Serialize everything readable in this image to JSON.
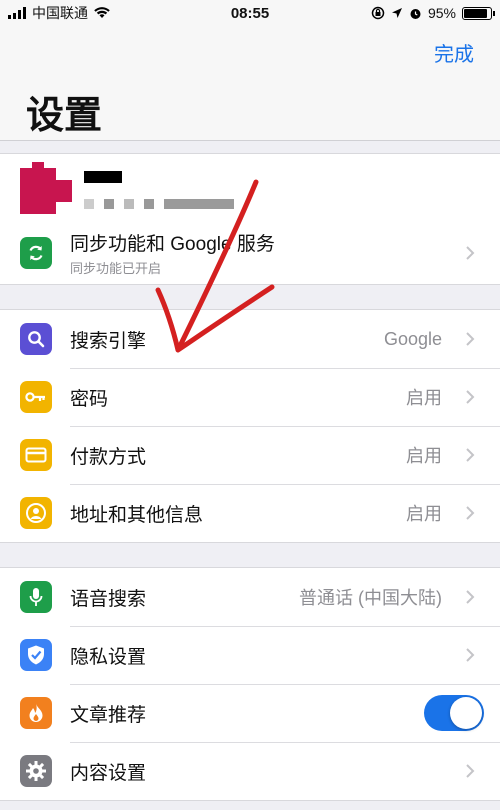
{
  "status": {
    "carrier": "中国联通",
    "time": "08:55",
    "battery": "95%",
    "battery_level": 0.95
  },
  "header": {
    "done_label": "完成",
    "title": "设置"
  },
  "sync": {
    "title": "同步功能和 Google 服务",
    "subtitle": "同步功能已开启"
  },
  "group2": [
    {
      "label": "搜索引擎",
      "value": "Google"
    },
    {
      "label": "密码",
      "value": "启用"
    },
    {
      "label": "付款方式",
      "value": "启用"
    },
    {
      "label": "地址和其他信息",
      "value": "启用"
    }
  ],
  "group3": [
    {
      "label": "语音搜索",
      "value": "普通话 (中国大陆)"
    },
    {
      "label": "隐私设置",
      "value": ""
    },
    {
      "label": "文章推荐",
      "toggle_on": true
    },
    {
      "label": "内容设置",
      "value": ""
    }
  ],
  "colors": {
    "accent": "#1a73e8",
    "sync_icon": "#1e9e4a",
    "search_icon": "#5b4fd4",
    "key_icon": "#f2b400",
    "card_icon": "#f2b400",
    "person_icon": "#f2b400",
    "mic_icon": "#1e9e4a",
    "shield_icon": "#3b82f6",
    "fire_icon": "#f2801e",
    "gear_icon": "#7a7a80",
    "annotation": "#d42020"
  }
}
